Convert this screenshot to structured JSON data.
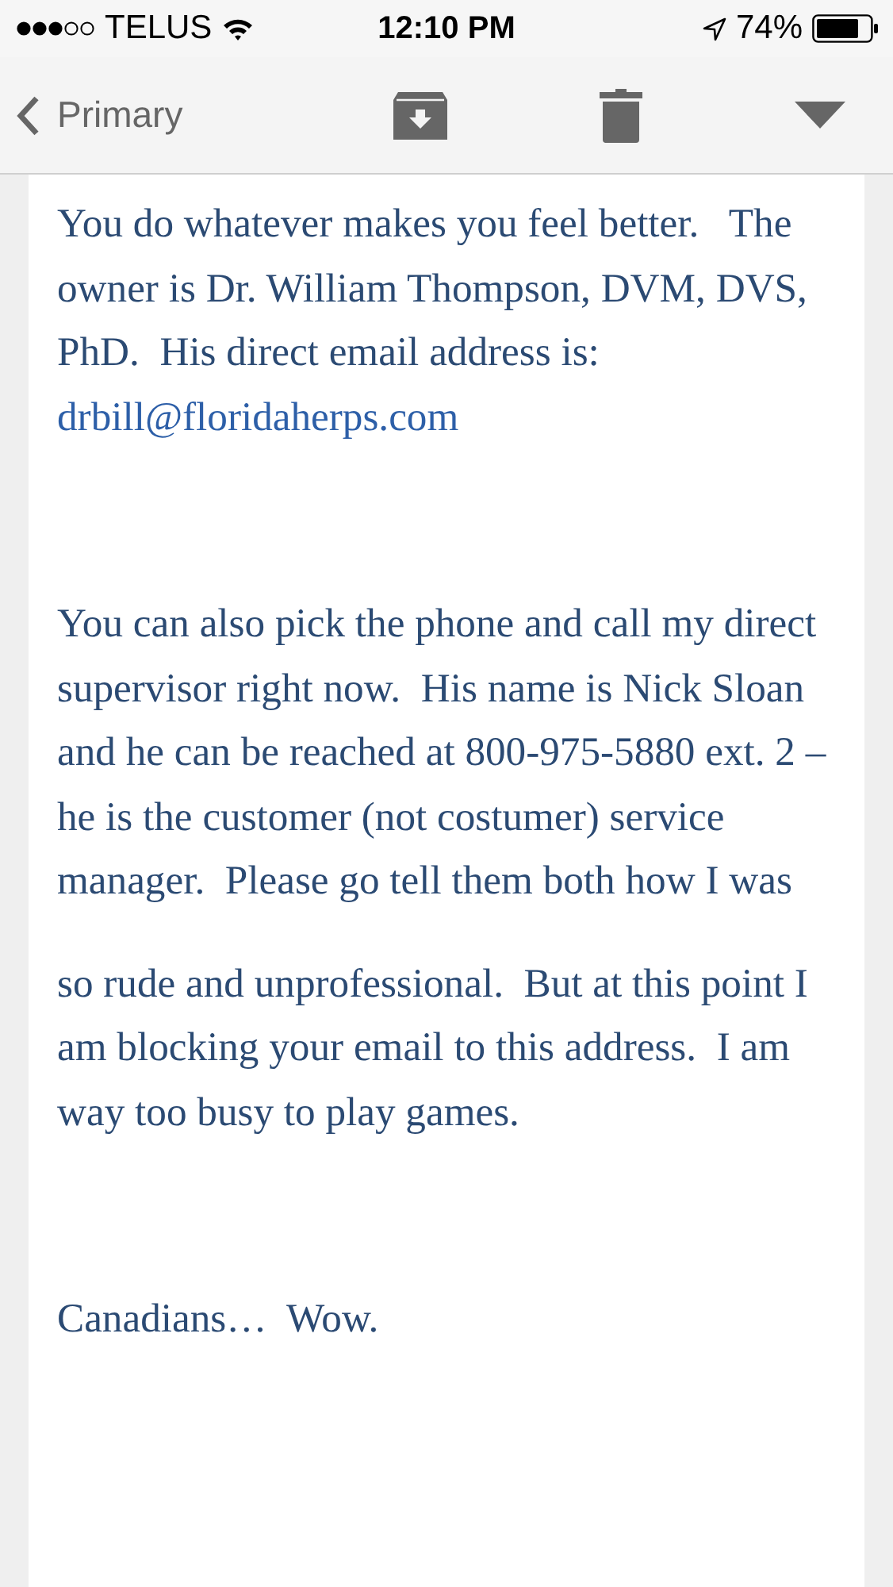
{
  "status_bar": {
    "carrier": "TELUS",
    "time": "12:10 PM",
    "battery": "74%"
  },
  "nav": {
    "back_label": "Primary"
  },
  "sections": [
    {
      "items": [
        {
          "kind": "text",
          "text": "You do whatever makes you feel better.   The owner is Dr. William Thompson, DVM, DVS, PhD.  His direct email address is:"
        },
        {
          "kind": "link",
          "text": "drbill@floridaherps.com"
        }
      ]
    },
    {
      "items": [
        {
          "kind": "text",
          "text": "You can also pick the phone and call my direct supervisor right now.  His name is Nick Sloan and he can be reached at 800-975-5880 ext. 2 – he is the customer (not costumer) service manager.  Please go tell them both how I was"
        },
        {
          "kind": "text",
          "text": "so rude and unprofessional.  But at this point I am blocking your email to this address.  I am way too busy to play games."
        }
      ]
    },
    {
      "items": [
        {
          "kind": "text",
          "text": "Canadians…  Wow."
        }
      ]
    }
  ]
}
